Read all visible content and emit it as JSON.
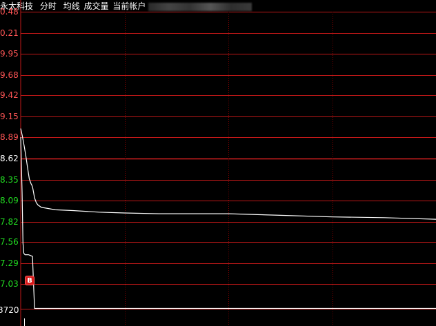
{
  "header": {
    "stock_name": "永太科技",
    "period_label": "分时",
    "avg_label": "均线",
    "volume_label": "成交量",
    "account_label": "当前帐户"
  },
  "colors": {
    "background": "#000000",
    "grid_red": "#c01818",
    "grid_dashed": "#800000",
    "axis_line": "#c01818",
    "price_line": "#ffffff",
    "axis_text_red": "#ff5555",
    "axis_text_green": "#22dd22",
    "axis_text_white": "#ffffff",
    "header_text": "#ffffff",
    "header_muted": "#e8e8e8",
    "marker_bg": "#d81818"
  },
  "markers": {
    "buy_label": "B"
  },
  "chart_data": {
    "type": "line",
    "title": "",
    "xlabel": "",
    "ylabel": "",
    "y_tick_labels": [
      "0.48",
      "0.21",
      "9.95",
      "9.68",
      "9.42",
      "9.15",
      "8.89",
      "8.62",
      "8.35",
      "8.09",
      "7.82",
      "7.56",
      "7.29",
      "7.03",
      "3720"
    ],
    "y_tick_values": [
      10.48,
      10.21,
      9.95,
      9.68,
      9.42,
      9.15,
      8.89,
      8.62,
      8.35,
      8.09,
      7.82,
      7.56,
      7.29,
      7.03,
      6.72
    ],
    "y_tick_colors": [
      "red",
      "red",
      "red",
      "red",
      "red",
      "red",
      "red",
      "white",
      "green",
      "green",
      "green",
      "green",
      "green",
      "green",
      "white"
    ],
    "ylim": [
      6.68,
      10.48
    ],
    "xlim": [
      0,
      240
    ],
    "vertical_grid_minutes": [
      60,
      120,
      180
    ],
    "grid": true,
    "series": [
      {
        "x": [
          0,
          1,
          2,
          3,
          4,
          5,
          6,
          6.5,
          7,
          8,
          9,
          10,
          12,
          15,
          20,
          30,
          45,
          60,
          80,
          90,
          120,
          150,
          180,
          210,
          240
        ],
        "y": [
          9.0,
          8.9,
          8.78,
          8.65,
          8.5,
          8.36,
          8.3,
          8.28,
          8.24,
          8.12,
          8.06,
          8.03,
          8.0,
          7.99,
          7.97,
          7.96,
          7.94,
          7.93,
          7.92,
          7.92,
          7.92,
          7.9,
          7.88,
          7.87,
          7.85
        ]
      },
      {
        "x": [
          0,
          0.8,
          1.3,
          1.8,
          2.5,
          3.3,
          4.5,
          6.8,
          7.3,
          8.0,
          240
        ],
        "y": [
          8.89,
          8.2,
          7.55,
          7.42,
          7.4,
          7.4,
          7.4,
          7.38,
          7.1,
          6.72,
          6.72
        ]
      }
    ],
    "markers": [
      {
        "label": "B",
        "x": 5,
        "y": 7.07
      }
    ]
  }
}
